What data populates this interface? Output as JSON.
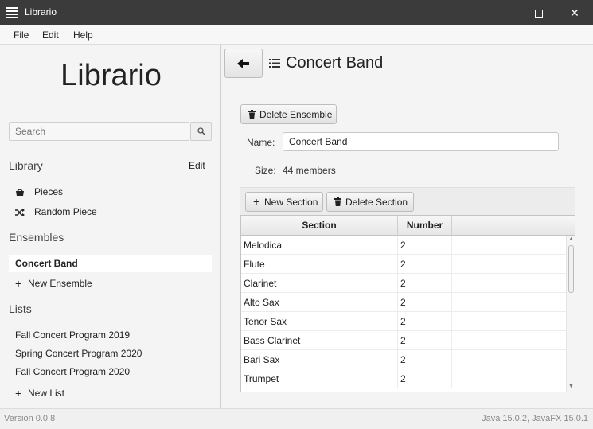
{
  "window": {
    "title": "Librario"
  },
  "menu": [
    "File",
    "Edit",
    "Help"
  ],
  "sidebar": {
    "brand": "Librario",
    "search_placeholder": "Search",
    "library": {
      "heading": "Library",
      "edit_label": "Edit",
      "items": [
        "Pieces",
        "Random Piece"
      ]
    },
    "ensembles": {
      "heading": "Ensembles",
      "items": [
        "Concert Band"
      ],
      "selected": "Concert Band",
      "new_label": "New Ensemble"
    },
    "lists": {
      "heading": "Lists",
      "items": [
        "Fall Concert Program 2019",
        "Spring Concert Program 2020",
        "Fall Concert Program 2020"
      ],
      "new_label": "New List"
    }
  },
  "main": {
    "title": "Concert Band",
    "delete_ensemble_label": "Delete Ensemble",
    "name_label": "Name:",
    "name_value": "Concert Band",
    "size_label": "Size:",
    "size_value": "44 members",
    "new_section_label": "New Section",
    "delete_section_label": "Delete Section",
    "table": {
      "columns": [
        "Section",
        "Number"
      ],
      "rows": [
        [
          "Melodica",
          "2"
        ],
        [
          "Flute",
          "2"
        ],
        [
          "Clarinet",
          "2"
        ],
        [
          "Alto Sax",
          "2"
        ],
        [
          "Tenor Sax",
          "2"
        ],
        [
          "Bass Clarinet",
          "2"
        ],
        [
          "Bari Sax",
          "2"
        ],
        [
          "Trumpet",
          "2"
        ]
      ]
    }
  },
  "status": {
    "version": "Version 0.0.8",
    "runtime": "Java 15.0.2, JavaFX 15.0.1"
  }
}
